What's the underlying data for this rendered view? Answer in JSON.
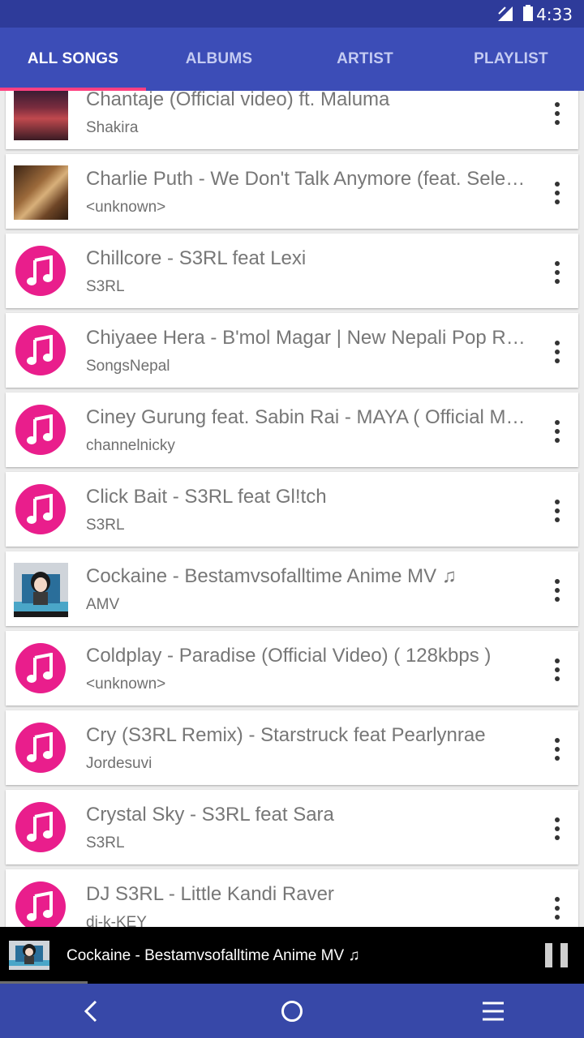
{
  "status_bar": {
    "time": "4:33"
  },
  "tabs": [
    {
      "label": "ALL SONGS",
      "active": true
    },
    {
      "label": "ALBUMS"
    },
    {
      "label": "ARTIST"
    },
    {
      "label": "PLAYLIST"
    }
  ],
  "songs": [
    {
      "title": "Chantaje (Official video) ft. Maluma",
      "artist": "Shakira",
      "art": "photo"
    },
    {
      "title": "Charlie Puth - We Don't Talk Anymore (feat. Sele…",
      "artist": "<unknown>",
      "art": "photo"
    },
    {
      "title": "Chillcore - S3RL feat Lexi",
      "artist": "S3RL",
      "art": "music-icon"
    },
    {
      "title": "Chiyaee Hera - B'mol Magar | New Nepali Pop R…",
      "artist": "SongsNepal",
      "art": "music-icon"
    },
    {
      "title": "Ciney Gurung feat. Sabin Rai - MAYA ( Official M…",
      "artist": "channelnicky",
      "art": "music-icon"
    },
    {
      "title": "Click Bait - S3RL feat Gl!tch",
      "artist": "S3RL",
      "art": "music-icon"
    },
    {
      "title": "Cockaine - Bestamvsofalltime Anime MV ♫",
      "artist": "AMV",
      "art": "photo"
    },
    {
      "title": "Coldplay - Paradise (Official Video) ( 128kbps )",
      "artist": "<unknown>",
      "art": "music-icon"
    },
    {
      "title": "Cry (S3RL Remix) - Starstruck feat Pearlynrae",
      "artist": "Jordesuvi",
      "art": "music-icon"
    },
    {
      "title": "Crystal Sky - S3RL feat Sara",
      "artist": "S3RL",
      "art": "music-icon"
    },
    {
      "title": "DJ S3RL - Little Kandi Raver",
      "artist": "dj-k-KEY",
      "art": "music-icon"
    }
  ],
  "now_playing": {
    "title": "Cockaine - Bestamvsofalltime Anime MV ♫",
    "progress": 0.15
  },
  "colors": {
    "status_bar": "#2e3b9a",
    "tab_bar": "#3c4db7",
    "tab_indicator": "#ff4081",
    "music_icon": "#e91e8c",
    "nav_bar": "#3748a8"
  }
}
